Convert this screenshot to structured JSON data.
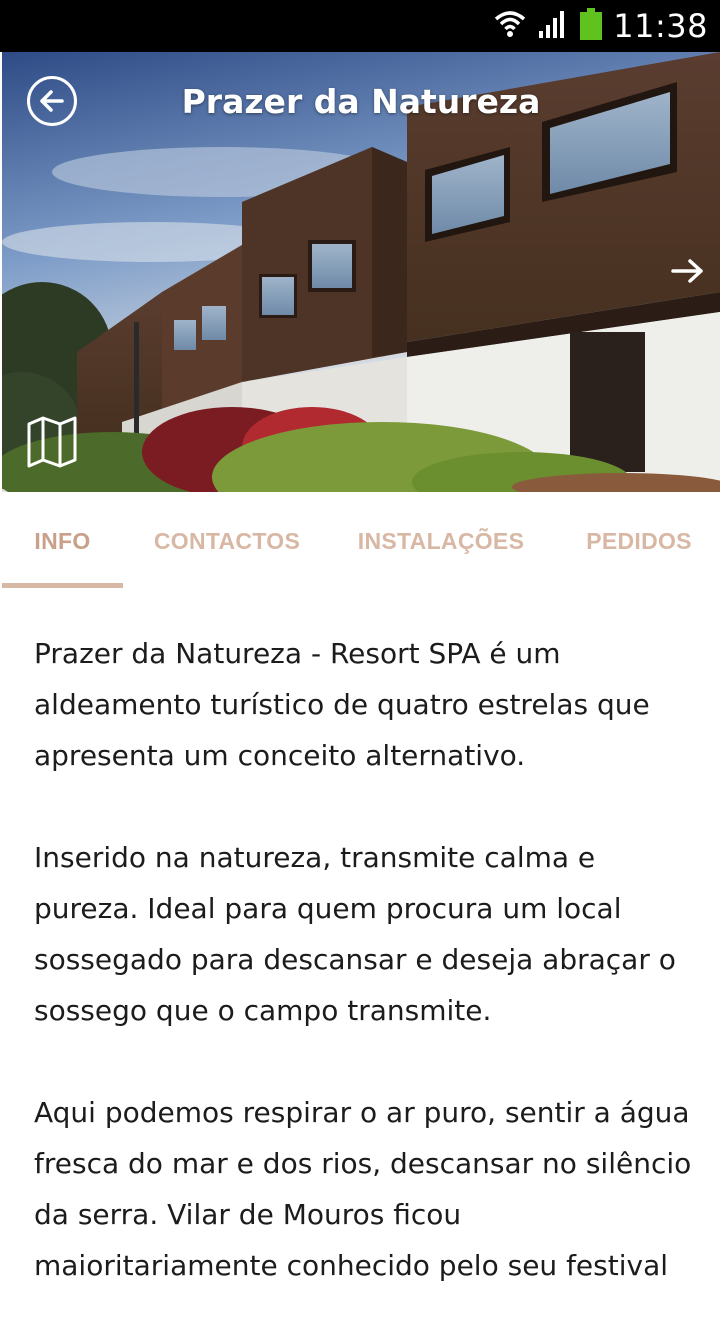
{
  "status_bar": {
    "time": "11:38",
    "icons": [
      "wifi-icon",
      "signal-icon",
      "battery-icon"
    ]
  },
  "header": {
    "title": "Prazer da Natureza",
    "back_icon": "arrow-left-circle-icon",
    "next_icon": "arrow-right-icon",
    "map_icon": "map-icon"
  },
  "tabs": [
    {
      "label": "INFO",
      "active": true
    },
    {
      "label": "CONTACTOS",
      "active": false
    },
    {
      "label": "INSTALAÇÕES",
      "active": false
    },
    {
      "label": "PEDIDOS",
      "active": false
    }
  ],
  "content": {
    "paragraphs": [
      "Prazer da Natureza - Resort SPA é um aldeamento turístico de quatro estrelas que apresenta um conceito alternativo.",
      "Inserido na natureza, transmite calma e pureza. Ideal para quem procura um local sossegado para descansar e deseja abraçar o sossego que o campo transmite.",
      "Aqui podemos respirar o ar puro, sentir a água fresca do mar e dos rios, descansar no silêncio da serra. Vilar de Mouros ficou maioritariamente conhecido pelo seu festival"
    ]
  },
  "colors": {
    "accent": "#c9a089",
    "tab_text": "#d8b8a4",
    "status_bar": "#000000",
    "battery": "#5fc21e"
  }
}
